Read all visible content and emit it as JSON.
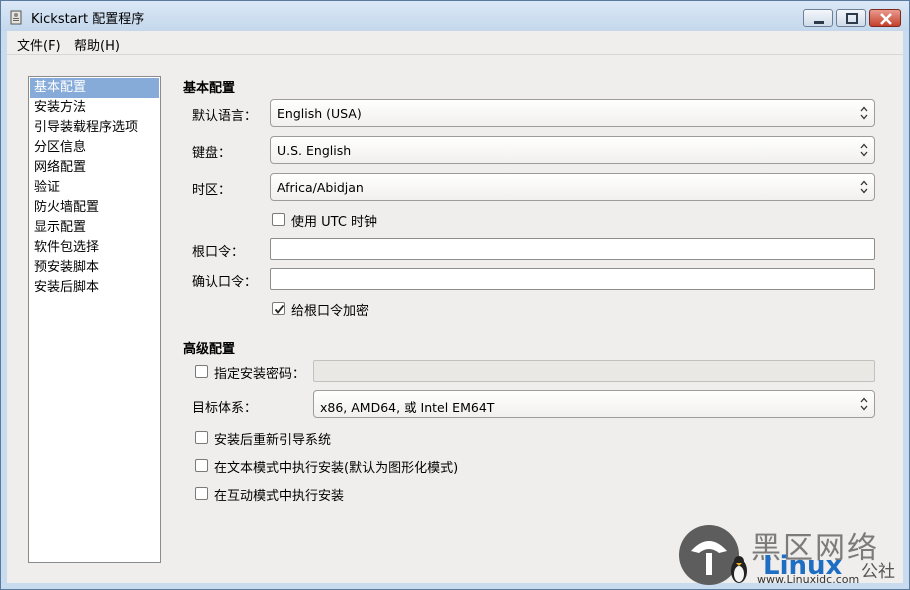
{
  "window": {
    "title": "Kickstart 配置程序"
  },
  "menu": {
    "file": "文件(F)",
    "help": "帮助(H)"
  },
  "sidebar": {
    "items": [
      {
        "label": "基本配置"
      },
      {
        "label": "安装方法"
      },
      {
        "label": "引导装载程序选项"
      },
      {
        "label": "分区信息"
      },
      {
        "label": "网络配置"
      },
      {
        "label": "验证"
      },
      {
        "label": "防火墙配置"
      },
      {
        "label": "显示配置"
      },
      {
        "label": "软件包选择"
      },
      {
        "label": "预安装脚本"
      },
      {
        "label": "安装后脚本"
      }
    ],
    "selected": "基本配置"
  },
  "basic": {
    "title": "基本配置",
    "language_label": "默认语言：",
    "language_value": "English (USA)",
    "keyboard_label": "键盘：",
    "keyboard_value": "U.S. English",
    "timezone_label": "时区：",
    "timezone_value": "Africa/Abidjan",
    "utc_label": "使用 UTC 时钟",
    "utc_checked": false,
    "root_pw_label": "根口令：",
    "root_pw_value": "",
    "confirm_pw_label": "确认口令：",
    "confirm_pw_value": "",
    "encrypt_label": "给根口令加密",
    "encrypt_checked": true
  },
  "advanced": {
    "title": "高级配置",
    "install_pw_label": "指定安装密码：",
    "install_pw_checked": false,
    "arch_label": "目标体系：",
    "arch_value": "x86, AMD64, 或 Intel EM64T",
    "reboot_label": "安装后重新引导系统",
    "reboot_checked": false,
    "text_mode_label": "在文本模式中执行安装(默认为图形化模式)",
    "text_mode_checked": false,
    "interactive_label": "在互动模式中执行安装",
    "interactive_checked": false
  },
  "watermark": {
    "line1": "黑区网络",
    "line2": "Linux",
    "line3": "www.Linuxidc.com",
    "line4": "公社"
  },
  "colors": {
    "selection": "#86abd9",
    "window_bg": "#efeeec",
    "title_bar": "#c9dcef"
  }
}
